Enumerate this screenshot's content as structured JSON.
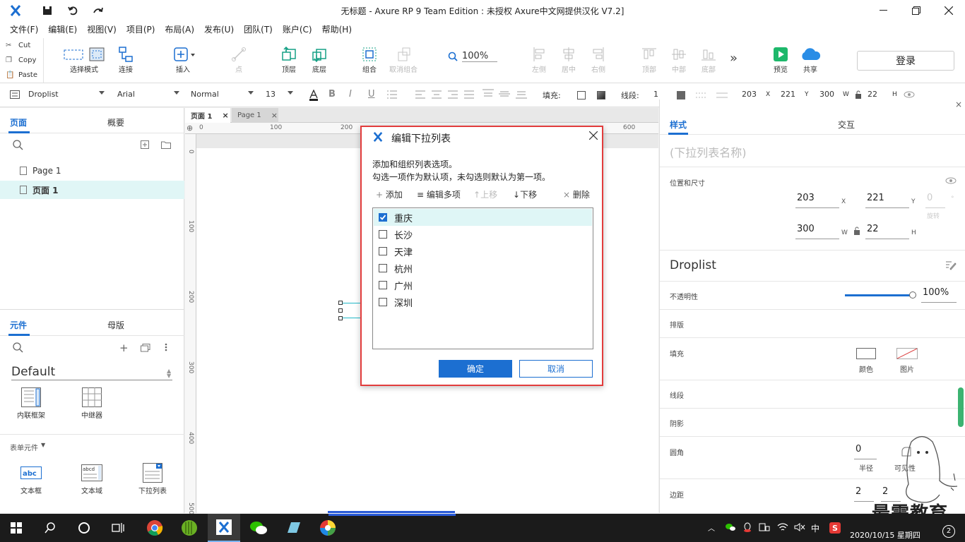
{
  "window": {
    "title": "无标题 - Axure RP 9 Team Edition : 未授权    Axure中文网提供汉化 V7.2]"
  },
  "menu": [
    "文件(F)",
    "编辑(E)",
    "视图(V)",
    "项目(P)",
    "布局(A)",
    "发布(U)",
    "团队(T)",
    "账户(C)",
    "帮助(H)"
  ],
  "clipboard": {
    "cut": "Cut",
    "copy": "Copy",
    "paste": "Paste"
  },
  "toolbar": {
    "select_mode": "选择模式",
    "connect": "连接",
    "insert": "插入",
    "point": "点",
    "top_layer": "顶层",
    "bottom_layer": "底层",
    "group": "组合",
    "ungroup": "取消组合",
    "zoom": "100%",
    "align_left": "左侧",
    "align_center": "居中",
    "align_right": "右侧",
    "align_top": "顶部",
    "align_middle": "中部",
    "align_bottom": "底部",
    "more": "»",
    "preview": "预览",
    "share": "共享",
    "login": "登录"
  },
  "format": {
    "widget_type": "Droplist",
    "font": "Arial",
    "style": "Normal",
    "size": "13",
    "fill_label": "填充:",
    "stroke_label": "线段:",
    "stroke_value": "1",
    "x": "203",
    "x_unit": "X",
    "y": "221",
    "y_unit": "Y",
    "w": "300",
    "w_unit": "W",
    "h": "22",
    "h_unit": "H"
  },
  "pages_panel": {
    "tab_pages": "页面",
    "tab_outline": "概要",
    "pages": [
      "Page 1",
      "页面 1"
    ]
  },
  "widgets_panel": {
    "tab_widgets": "元件",
    "tab_masters": "母版",
    "library": "Default",
    "row1": [
      "内联框架",
      "中继器"
    ],
    "section": "表单元件",
    "row2": [
      "文本框",
      "文本域",
      "下拉列表"
    ]
  },
  "canvas": {
    "tabs": [
      "页面 1",
      "Page 1"
    ],
    "hruler": [
      "0",
      "100",
      "200",
      "600"
    ],
    "vruler": [
      "0",
      "100",
      "200",
      "300",
      "400",
      "500"
    ]
  },
  "dialog": {
    "title": "编辑下拉列表",
    "desc1": "添加和组织列表选项。",
    "desc2": "勾选一项作为默认项，未勾选则默认为第一项。",
    "add": "添加",
    "edit_multi": "编辑多项",
    "move_up": "上移",
    "move_down": "下移",
    "delete": "删除",
    "options": [
      "重庆",
      "长沙",
      "天津",
      "杭州",
      "广州",
      "深圳"
    ],
    "ok": "确定",
    "cancel": "取消"
  },
  "inspector": {
    "tab_style": "样式",
    "tab_interaction": "交互",
    "name_placeholder": "(下拉列表名称)",
    "pos_size": "位置和尺寸",
    "x": "203",
    "x_unit": "X",
    "y": "221",
    "y_unit": "Y",
    "rot": "0",
    "rot_label": "旋转",
    "rot_unit": "°",
    "w": "300",
    "w_unit": "W",
    "h": "22",
    "h_unit": "H",
    "style_name": "Droplist",
    "opacity_label": "不透明性",
    "opacity_value": "100%",
    "opacity": 1.0,
    "arrange": "排版",
    "fill": "填充",
    "fill_color": "颜色",
    "fill_image": "图片",
    "stroke": "线段",
    "shadow": "阴影",
    "corner": "圆角",
    "corner_value": "0",
    "corner_radius": "半径",
    "corner_visible": "可见性",
    "padding": "边距",
    "padding_values": [
      "2",
      "2"
    ]
  },
  "watermark": "最需教育",
  "taskbar": {
    "ime": "中",
    "datetime": "2020/10/15 星期四",
    "notif": "2"
  },
  "colors": {
    "accent": "#1c6fd1",
    "dialog_border": "#e23c3c",
    "selected_row": "#dff6f6",
    "taskbar": "#1b1b1b"
  }
}
